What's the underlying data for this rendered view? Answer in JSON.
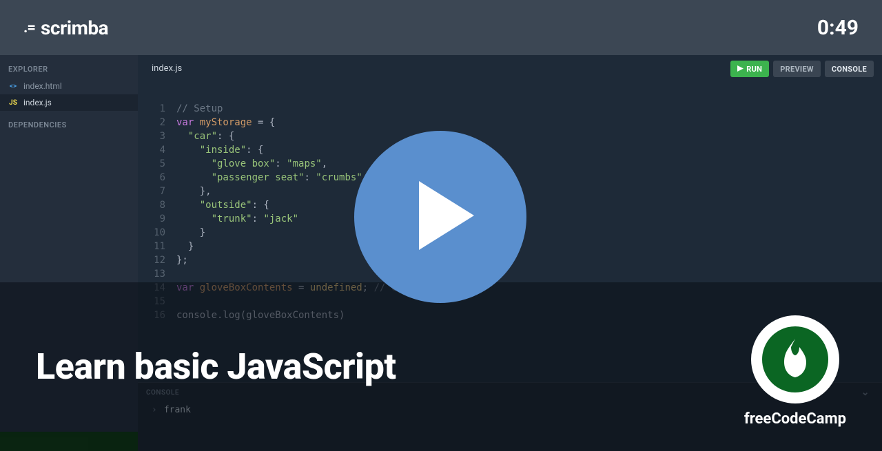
{
  "header": {
    "brand": "scrimba",
    "timestamp": "0:49"
  },
  "sidebar": {
    "explorer_label": "EXPLORER",
    "dependencies_label": "DEPENDENCIES",
    "files": [
      {
        "name": "index.html",
        "ext": "<>",
        "active": false
      },
      {
        "name": "index.js",
        "ext": "JS",
        "active": true
      }
    ]
  },
  "tabs": {
    "open_file": "index.js",
    "run_label": "RUN",
    "preview_label": "PREVIEW",
    "console_label": "CONSOLE"
  },
  "editor": {
    "lines": [
      {
        "n": 1,
        "tokens": [
          [
            "// Setup",
            "comment"
          ]
        ]
      },
      {
        "n": 2,
        "tokens": [
          [
            "var ",
            "keyword"
          ],
          [
            "myStorage",
            "var"
          ],
          [
            " = {",
            "punct"
          ]
        ]
      },
      {
        "n": 3,
        "tokens": [
          [
            "  ",
            null
          ],
          [
            "\"car\"",
            "string"
          ],
          [
            ": {",
            "punct"
          ]
        ]
      },
      {
        "n": 4,
        "tokens": [
          [
            "    ",
            null
          ],
          [
            "\"inside\"",
            "string"
          ],
          [
            ": {",
            "punct"
          ]
        ]
      },
      {
        "n": 5,
        "tokens": [
          [
            "      ",
            null
          ],
          [
            "\"glove box\"",
            "string"
          ],
          [
            ": ",
            "punct"
          ],
          [
            "\"maps\"",
            "string"
          ],
          [
            ",",
            "punct"
          ]
        ]
      },
      {
        "n": 6,
        "tokens": [
          [
            "      ",
            null
          ],
          [
            "\"passenger seat\"",
            "string"
          ],
          [
            ": ",
            "punct"
          ],
          [
            "\"crumbs\"",
            "string"
          ]
        ]
      },
      {
        "n": 7,
        "tokens": [
          [
            "    },",
            "punct"
          ]
        ]
      },
      {
        "n": 8,
        "tokens": [
          [
            "    ",
            null
          ],
          [
            "\"outside\"",
            "string"
          ],
          [
            ": {",
            "punct"
          ]
        ]
      },
      {
        "n": 9,
        "tokens": [
          [
            "      ",
            null
          ],
          [
            "\"trunk\"",
            "string"
          ],
          [
            ": ",
            "punct"
          ],
          [
            "\"jack\"",
            "string"
          ]
        ]
      },
      {
        "n": 10,
        "tokens": [
          [
            "    }",
            "punct"
          ]
        ]
      },
      {
        "n": 11,
        "tokens": [
          [
            "  }",
            "punct"
          ]
        ]
      },
      {
        "n": 12,
        "tokens": [
          [
            "};",
            "punct"
          ]
        ]
      },
      {
        "n": 13,
        "tokens": [
          [
            "",
            null
          ]
        ]
      },
      {
        "n": 14,
        "tokens": [
          [
            "var ",
            "keyword"
          ],
          [
            "gloveBoxContents",
            "var"
          ],
          [
            " = ",
            "punct"
          ],
          [
            "undefined",
            "undef"
          ],
          [
            "; ",
            "punct"
          ],
          [
            "// Change this line",
            "comment"
          ]
        ]
      },
      {
        "n": 15,
        "tokens": [
          [
            "",
            null
          ]
        ]
      },
      {
        "n": 16,
        "tokens": [
          [
            "console.log(gloveBoxContents)",
            "punct"
          ]
        ]
      }
    ]
  },
  "console": {
    "title": "CONSOLE",
    "output": "frank"
  },
  "overlay": {
    "title": "Learn basic JavaScript",
    "channel": "freeCodeCamp"
  }
}
